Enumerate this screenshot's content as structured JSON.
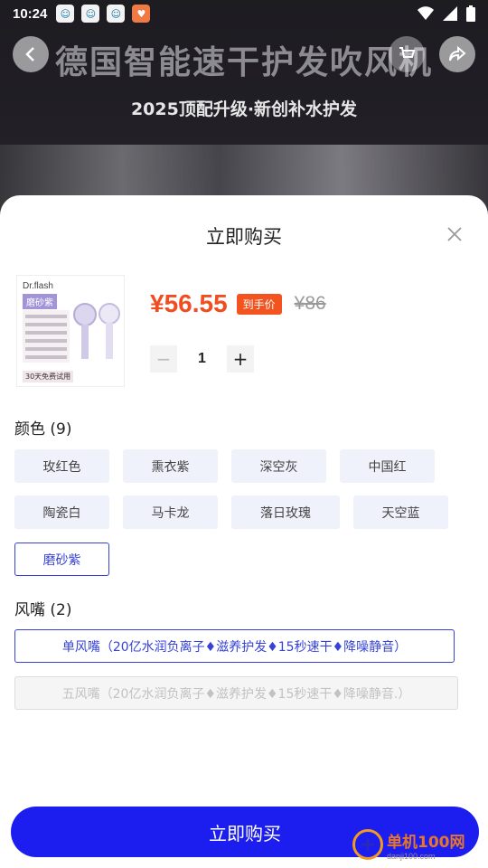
{
  "status_bar": {
    "time": "10:24",
    "app_icons": [
      "app-icon-1",
      "app-icon-2",
      "app-icon-3",
      "heart-app-icon"
    ],
    "indicators": [
      "wifi-icon",
      "signal-icon",
      "battery-icon"
    ]
  },
  "hero": {
    "title": "德国智能速干护发吹风机",
    "subtitle": "2025顶配升级·新创补水护发"
  },
  "sheet": {
    "title": "立即购买",
    "product": {
      "image_brand": "Dr.flash",
      "image_color": "磨砂紫",
      "image_foot": "30天免费试用",
      "price": "¥56.55",
      "price_tag": "到手价",
      "original_price": "¥86",
      "quantity": "1",
      "minus_label": "−",
      "plus_label": "+"
    },
    "color_section": {
      "label": "颜色 (9)",
      "options": [
        "玫红色",
        "熏衣紫",
        "深空灰",
        "中国红",
        "陶瓷白",
        "马卡龙",
        "落日玫瑰",
        "天空蓝",
        "磨砂紫"
      ],
      "selected": "磨砂紫"
    },
    "nozzle_section": {
      "label": "风嘴 (2)",
      "options": [
        "单风嘴（20亿水润负离子♦滋养护发♦15秒速干♦降噪静音）",
        "五风嘴（20亿水润负离子♦滋养护发♦15秒速干♦降噪静音.）"
      ],
      "selected": "单风嘴（20亿水润负离子♦滋养护发♦15秒速干♦降噪静音）",
      "disabled": "五风嘴（20亿水润负离子♦滋养护发♦15秒速干♦降噪静音.）"
    },
    "buy_button": "立即购买"
  },
  "watermark": {
    "main": "单机100网",
    "sub": "danji100.com"
  },
  "colors": {
    "accent_blue": "#1c1ef0",
    "price_orange": "#f04e22",
    "chip_bg": "#eff1fb",
    "selected_border": "#3643d6"
  }
}
